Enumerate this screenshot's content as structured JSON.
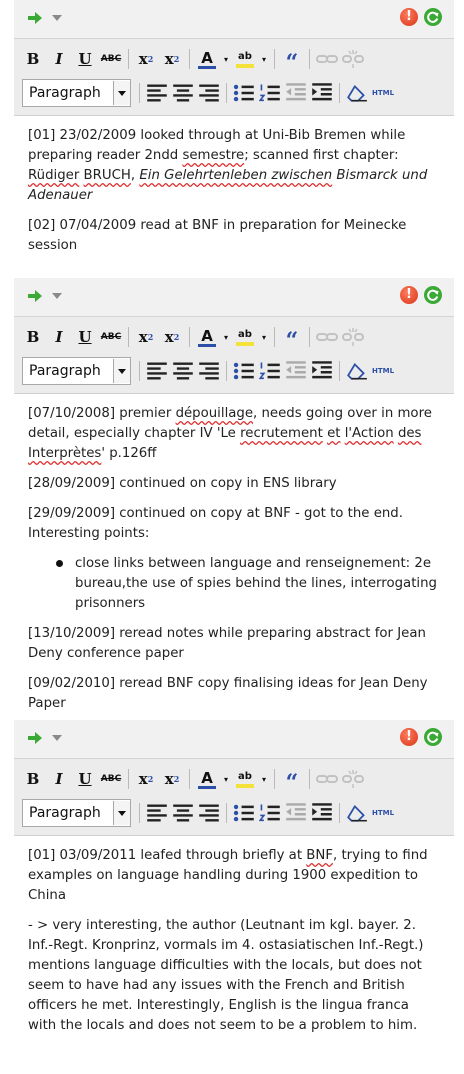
{
  "editors": [
    {
      "format_select": "Paragraph",
      "entries": [
        {
          "parts": [
            {
              "t": "[01] 23/02/2009 looked through at Uni-Bib Bremen while preparing reader 2ndd "
            },
            {
              "t": "semestre",
              "sq": true
            },
            {
              "t": "; scanned first chapter: "
            },
            {
              "t": "Rüdiger",
              "sq": true
            },
            {
              "t": " "
            },
            {
              "t": "BRUCH",
              "sq": true
            },
            {
              "t": ", "
            },
            {
              "t": "Ein Gelehrtenleben zwischen",
              "sq": true,
              "i": true
            },
            {
              "t": " Bismarck und Adenauer",
              "i": true
            }
          ]
        },
        {
          "parts": [
            {
              "t": "[02] 07/04/2009 read at BNF in preparation for Meinecke session"
            }
          ]
        }
      ]
    },
    {
      "format_select": "Paragraph",
      "entries": [
        {
          "parts": [
            {
              "t": "[07/10/2008] premier "
            },
            {
              "t": "dépouillage",
              "sq": true
            },
            {
              "t": ", needs going over in more detail, especially chapter IV 'Le "
            },
            {
              "t": "recrutement",
              "sq": true
            },
            {
              "t": " "
            },
            {
              "t": "et",
              "sq": true
            },
            {
              "t": " "
            },
            {
              "t": "l'Action",
              "sq": true
            },
            {
              "t": " "
            },
            {
              "t": "des",
              "sq": true
            },
            {
              "t": " "
            },
            {
              "t": "Interprètes",
              "sq": true
            },
            {
              "t": "' p.126ff"
            }
          ]
        },
        {
          "parts": [
            {
              "t": "[28/09/2009] continued on copy  in ENS library"
            }
          ]
        },
        {
          "parts": [
            {
              "t": "[29/09/2009] continued on copy at BNF - got to the end. Interesting points:"
            }
          ]
        },
        {
          "bullet": true,
          "parts": [
            {
              "t": "close links between language and renseignement: 2e bureau,the use of spies behind the lines, interrogating prisonners"
            }
          ]
        },
        {
          "parts": [
            {
              "t": "[13/10/2009] reread notes while preparing abstract for Jean Deny conference paper"
            }
          ]
        },
        {
          "parts": [
            {
              "t": "[09/02/2010] reread BNF copy finalising ideas for Jean Deny Paper"
            }
          ]
        }
      ]
    },
    {
      "format_select": "Paragraph",
      "entries": [
        {
          "parts": [
            {
              "t": "[01] 03/09/2011 leafed through briefly at "
            },
            {
              "t": "BNF",
              "sq": true
            },
            {
              "t": ", trying to find examples on language handling during 1900 expedition to China"
            }
          ]
        },
        {
          "parts": [
            {
              "t": "- > very interesting, the author (Leutnant im kgl. bayer. 2. Inf.-Regt. Kronprinz, vormals im 4. ostasiatischen Inf.-Regt.) mentions language difficulties with the locals, but does not seem to have had any issues with the French and British officers he met. Interestingly, English is the lingua franca with the locals and does not seem to be a problem to him."
            }
          ]
        }
      ]
    }
  ],
  "toolbar": {
    "bold": "B",
    "italic": "I",
    "underline": "U",
    "strike": "ABC",
    "subscript": "x",
    "subscript_mark": "2",
    "superscript": "x",
    "superscript_mark": "2",
    "text_color": "A",
    "highlight": "ab",
    "quote": "“",
    "html": "HTML"
  },
  "icons": {
    "arrow": "green-arrow-icon",
    "dropdown": "chevron-down-icon",
    "warning": "warning-icon",
    "refresh": "refresh-icon",
    "link": "link-icon",
    "unlink": "unlink-icon",
    "align_left": "align-left-icon",
    "align_center": "align-center-icon",
    "align_right": "align-right-icon",
    "bullet_list": "bullet-list-icon",
    "numbered_list": "numbered-list-icon",
    "outdent": "outdent-icon",
    "indent": "indent-icon",
    "eraser": "eraser-icon"
  },
  "colors": {
    "accent_green": "#3aa935",
    "warning_red": "#e2472a",
    "text_color_blue": "#2c4fa8",
    "highlight_yellow": "#f4e23a"
  }
}
